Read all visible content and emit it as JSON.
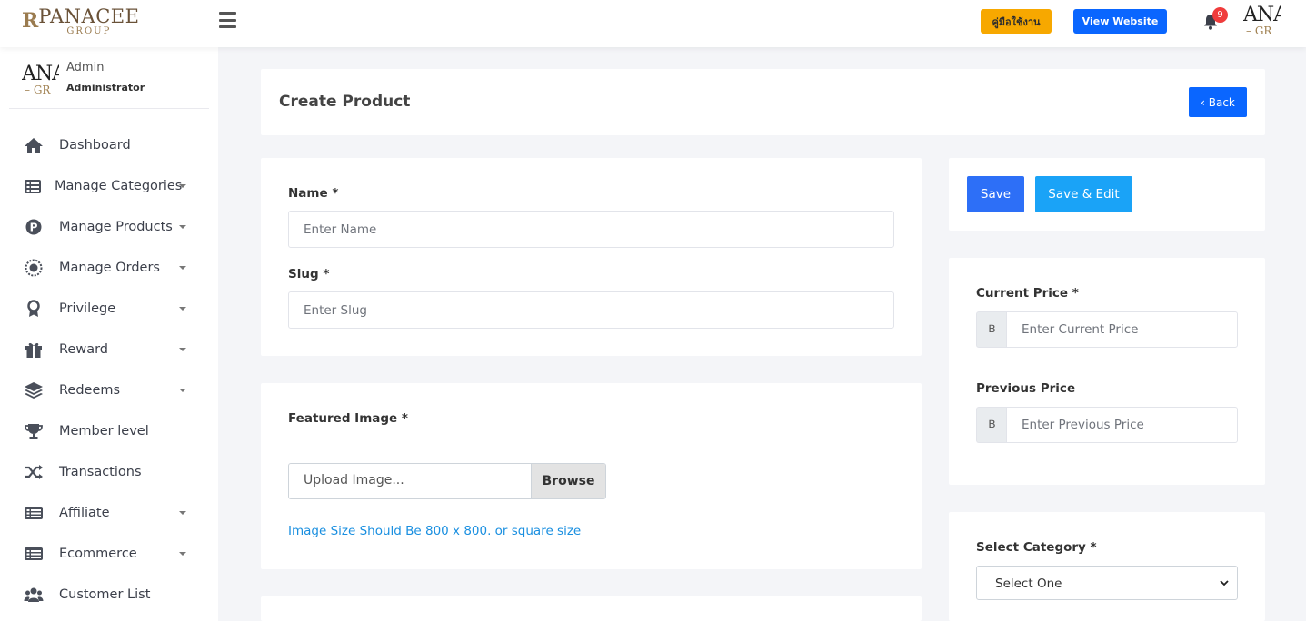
{
  "brand": {
    "logo_mark": "R",
    "logo_name": "PANACEE",
    "logo_sub": "GROUP"
  },
  "topbar": {
    "manual_label": "คู่มือใช้งาน",
    "website_label": "View Website",
    "notification_count": "9",
    "avatar_line1": "ANA",
    "avatar_line2": "– GR"
  },
  "user": {
    "name": "Admin",
    "role": "Administrator",
    "avatar_line1": "ANA",
    "avatar_line2": "– GR"
  },
  "sidebar": {
    "items": [
      {
        "label": "Dashboard",
        "icon": "home-icon",
        "has_caret": false
      },
      {
        "label": "Manage Categories",
        "icon": "list-icon",
        "has_caret": true
      },
      {
        "label": "Manage Products",
        "icon": "product-p-icon",
        "has_caret": true
      },
      {
        "label": "Manage Orders",
        "icon": "orders-icon",
        "has_caret": true
      },
      {
        "label": "Privilege",
        "icon": "award-icon",
        "has_caret": true
      },
      {
        "label": "Reward",
        "icon": "gift-icon",
        "has_caret": true
      },
      {
        "label": "Redeems",
        "icon": "layers-icon",
        "has_caret": true
      },
      {
        "label": "Member level",
        "icon": "trophy-icon",
        "has_caret": false
      },
      {
        "label": "Transactions",
        "icon": "shuffle-icon",
        "has_caret": false
      },
      {
        "label": "Affiliate",
        "icon": "affiliate-list-icon",
        "has_caret": true
      },
      {
        "label": "Ecommerce",
        "icon": "ecommerce-list-icon",
        "has_caret": true
      },
      {
        "label": "Customer List",
        "icon": "users-icon",
        "has_caret": false
      }
    ]
  },
  "header": {
    "title": "Create Product",
    "back_label": "Back"
  },
  "form": {
    "name_label": "Name *",
    "name_placeholder": "Enter Name",
    "slug_label": "Slug *",
    "slug_placeholder": "Enter Slug",
    "image_label": "Featured Image *",
    "upload_placeholder": "Upload Image...",
    "browse_label": "Browse",
    "image_hint": "Image Size Should Be 800 x 800. or square size"
  },
  "actions": {
    "save_label": "Save",
    "save_edit_label": "Save & Edit"
  },
  "pricing": {
    "currency_symbol": "฿",
    "current_label": "Current Price *",
    "current_placeholder": "Enter Current Price",
    "previous_label": "Previous Price",
    "previous_placeholder": "Enter Previous Price"
  },
  "category": {
    "label": "Select Category *",
    "selected": "Select One"
  },
  "colors": {
    "primary": "#0a66ff",
    "warning": "#f7a800",
    "save": "#2d6ff7",
    "save_edit": "#1aa3f7",
    "badge": "#f03c3c",
    "hint": "#1a8fe0"
  }
}
